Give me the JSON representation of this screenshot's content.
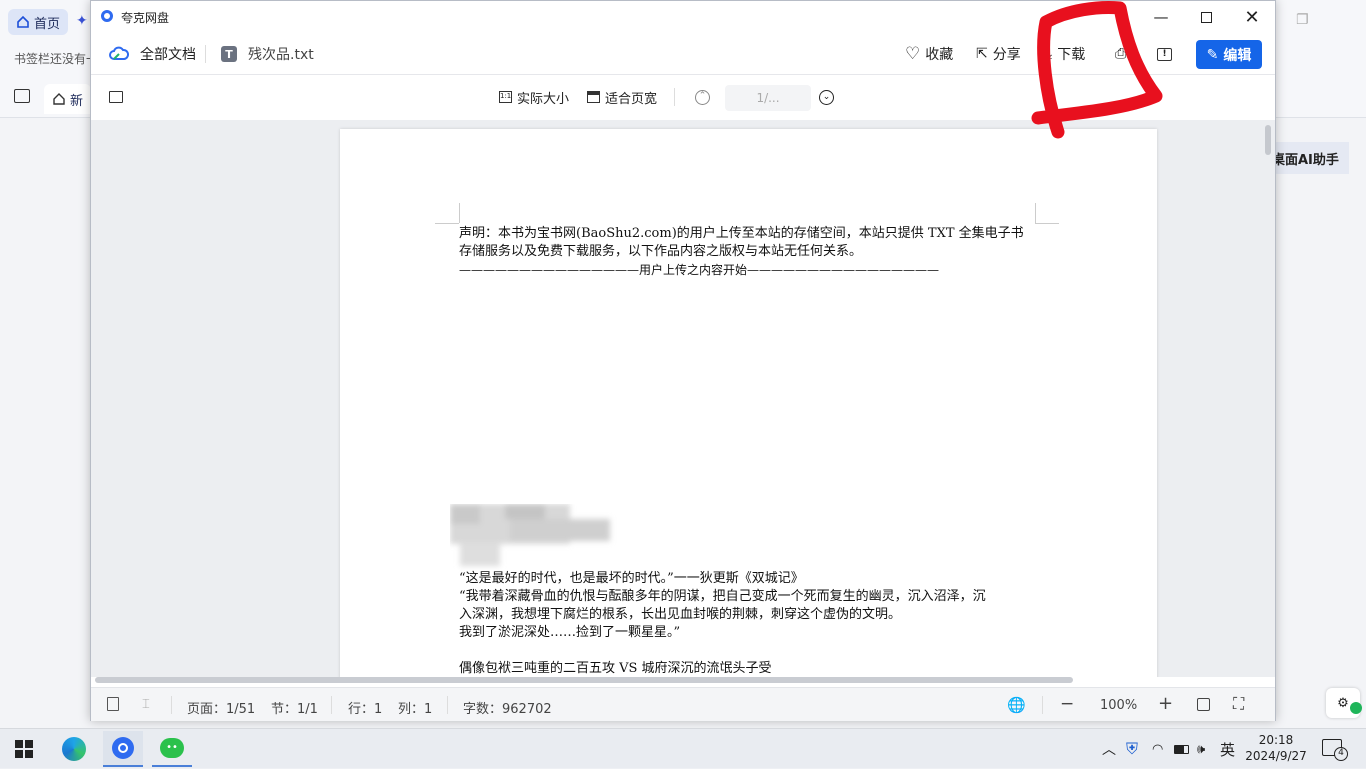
{
  "browser": {
    "home_tab": "首页",
    "bookmark_hint": "书签栏还没有一",
    "new_tab": "新",
    "ai_assistant": "桌面AI助手"
  },
  "window": {
    "app_title": "夸克网盘",
    "breadcrumb_root": "全部文档",
    "file_name": "残次品.txt",
    "file_icon_letter": "T",
    "actions": {
      "favorite": "收藏",
      "share": "分享",
      "download": "下载",
      "edit": "编辑"
    }
  },
  "viewbar": {
    "actual_size": "实际大小",
    "fit_width": "适合页宽",
    "page_input": "1/..."
  },
  "document": {
    "line1": "声明：本书为宝书网(BaoShu2.com)的用户上传至本站的存储空间，本站只提供 TXT 全集电子书",
    "line2": "存储服务以及免费下载服务，以下作品内容之版权与本站无任何关系。",
    "line3": "———————————————用户上传之内容开始————————————————",
    "quote1": "“这是最好的时代，也是最坏的时代。”一一狄更斯《双城记》",
    "quote2a": "“我带着深藏骨血的仇恨与酝酿多年的阴谋，把自己变成一个死而复生的幽灵，沉入沼泽，沉",
    "quote2b": "入深渊，我想埋下腐烂的根系，长出见血封喉的荆棘，刺穿这个虚伪的文明。",
    "quote3": "我到了淤泥深处……捡到了一颗星星。”",
    "partial": "偶像包袱三吨重的二百五攻 VS 城府深沉的流氓头子受"
  },
  "statusbar": {
    "page": "页面：1/51",
    "section": "节：1/1",
    "row": "行：1",
    "col": "列：1",
    "word_count": "字数：962702",
    "zoom": "100%"
  },
  "taskbar": {
    "ime": "英",
    "time": "20:18",
    "date": "2024/9/27",
    "notifications": "4"
  },
  "colors": {
    "accent": "#1565e8",
    "annotation": "#e8101e"
  }
}
